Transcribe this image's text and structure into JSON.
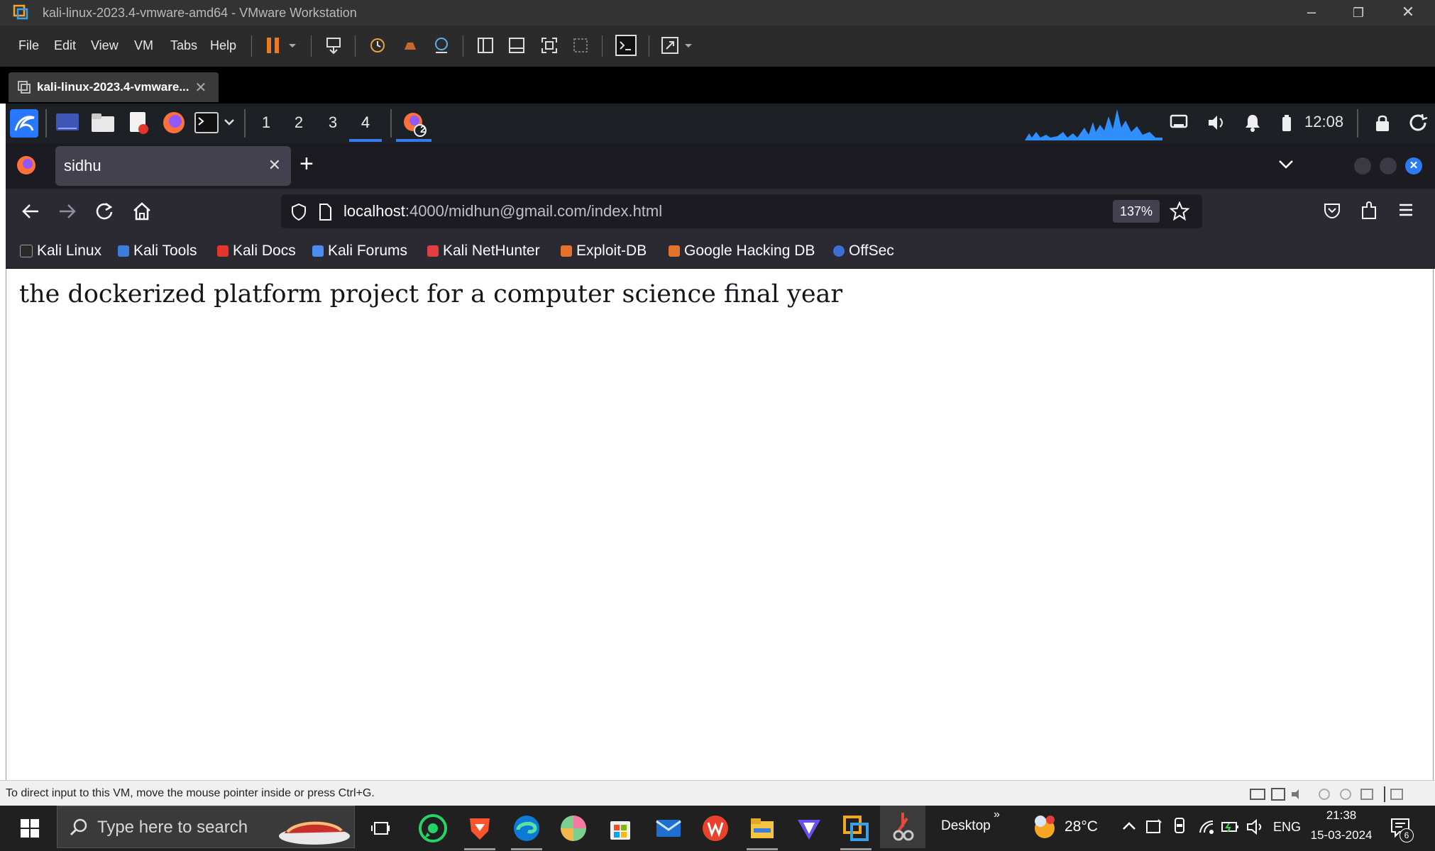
{
  "vmware": {
    "window_title": "kali-linux-2023.4-vmware-amd64 - VMware Workstation",
    "menu": [
      "File",
      "Edit",
      "View",
      "VM",
      "Tabs",
      "Help"
    ],
    "tab_label": "kali-linux-2023.4-vmware...",
    "status_text": "To direct input to this VM, move the mouse pointer inside or press Ctrl+G."
  },
  "kali_panel": {
    "workspaces": [
      "1",
      "2",
      "3",
      "4"
    ],
    "active_workspace": "4",
    "notification_badge": "2",
    "clock": "12:08"
  },
  "firefox": {
    "tab_title": "sidhu",
    "url_host": "localhost",
    "url_path": ":4000/midhun@gmail.com/index.html",
    "zoom": "137%",
    "bookmarks": [
      "Kali Linux",
      "Kali Tools",
      "Kali Docs",
      "Kali Forums",
      "Kali NetHunter",
      "Exploit-DB",
      "Google Hacking DB",
      "OffSec"
    ]
  },
  "page": {
    "body_text": "the dockerized platform project for a computer science final year"
  },
  "taskbar": {
    "search_placeholder": "Type here to search",
    "desktop_label": "Desktop",
    "weather_temp": "28°C",
    "language": "ENG",
    "time": "21:38",
    "date": "15-03-2024",
    "notification_count": "6"
  },
  "colors": {
    "vm_titlebar": "#333333",
    "kali_panel": "#1d2025",
    "firefox_bg": "#2b2a33",
    "accent": "#367bf0"
  }
}
